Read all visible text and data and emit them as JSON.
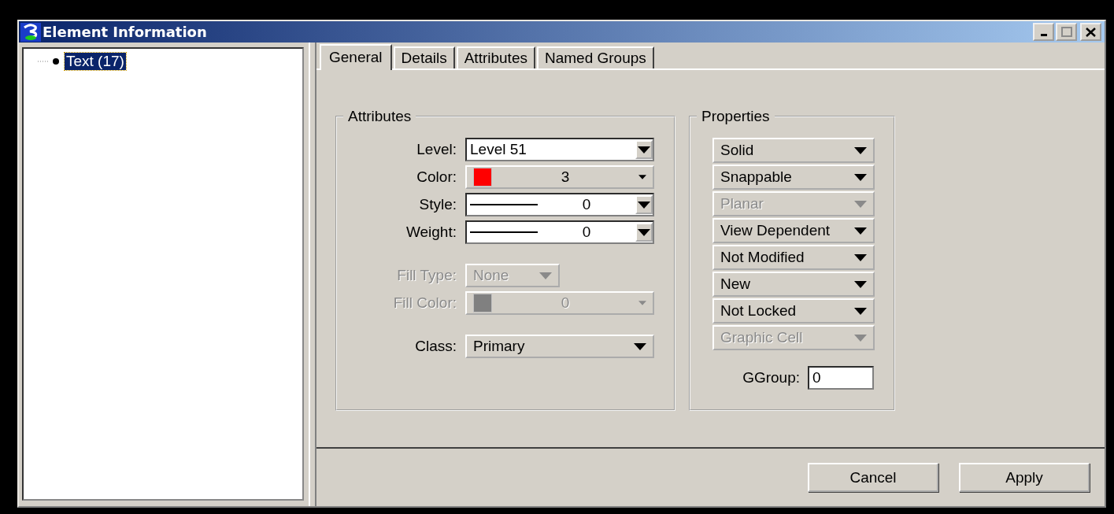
{
  "window": {
    "title": "Element Information"
  },
  "tree": {
    "items": [
      {
        "label": "Text (17)",
        "selected": true
      }
    ]
  },
  "tabs": [
    {
      "label": "General",
      "selected": true
    },
    {
      "label": "Details",
      "selected": false
    },
    {
      "label": "Attributes",
      "selected": false
    },
    {
      "label": "Named Groups",
      "selected": false
    }
  ],
  "attributes": {
    "title": "Attributes",
    "fields": [
      {
        "label": "Level:",
        "kind": "dropdown",
        "value": "Level 51",
        "disabled": false
      },
      {
        "label": "Color:",
        "kind": "color",
        "value": "3",
        "color": "#ff0000",
        "disabled": false
      },
      {
        "label": "Style:",
        "kind": "line",
        "value": "0",
        "disabled": false
      },
      {
        "label": "Weight:",
        "kind": "line",
        "value": "0",
        "disabled": false
      },
      {
        "label": "Fill Type:",
        "kind": "button",
        "value": "None",
        "compact": true,
        "disabled": true
      },
      {
        "label": "Fill Color:",
        "kind": "color",
        "value": "0",
        "color": "#808080",
        "disabled": true
      },
      {
        "label": "Class:",
        "kind": "button",
        "value": "Primary",
        "compact": false,
        "disabled": false
      }
    ]
  },
  "properties": {
    "title": "Properties",
    "items": [
      {
        "value": "Solid",
        "disabled": false
      },
      {
        "value": "Snappable",
        "disabled": false
      },
      {
        "value": "Planar",
        "disabled": true
      },
      {
        "value": "View Dependent",
        "disabled": false
      },
      {
        "value": "Not Modified",
        "disabled": false
      },
      {
        "value": "New",
        "disabled": false
      },
      {
        "value": "Not Locked",
        "disabled": false
      },
      {
        "value": "Graphic Cell",
        "disabled": true
      }
    ],
    "ggroup": {
      "label": "GGroup:",
      "value": "0"
    }
  },
  "buttons": [
    "Cancel",
    "Apply"
  ]
}
